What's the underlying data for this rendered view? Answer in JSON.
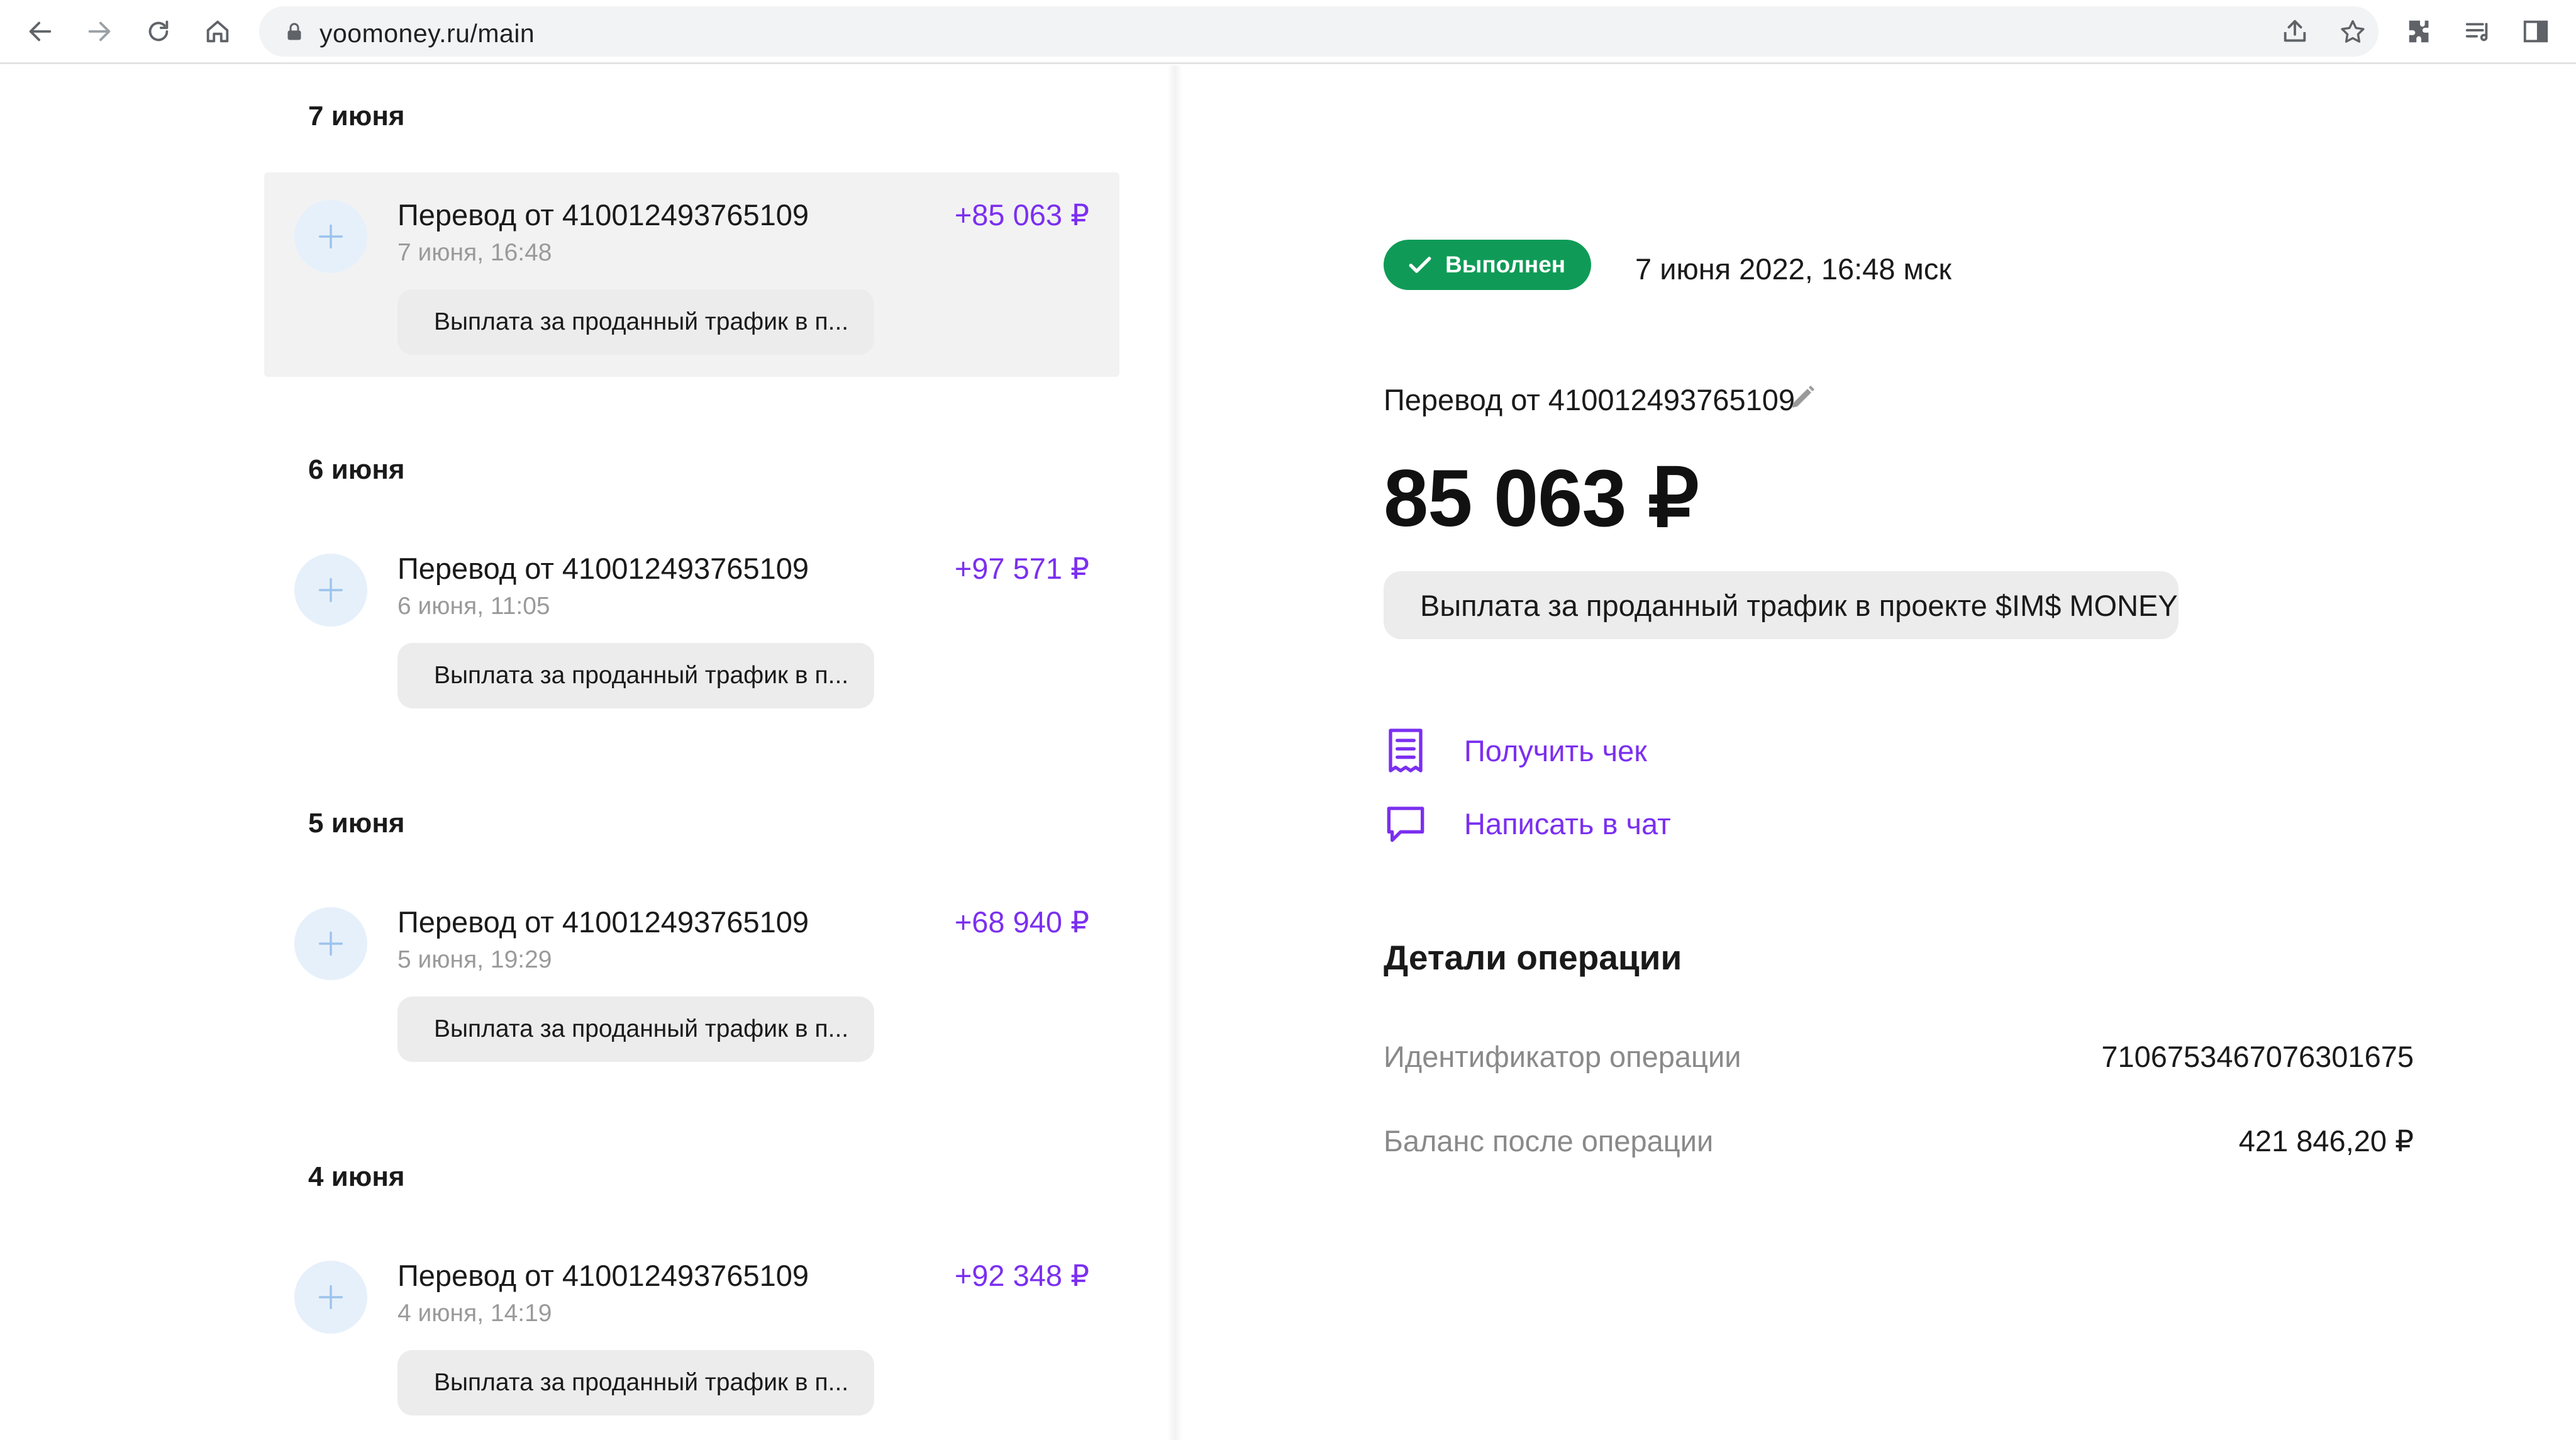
{
  "browser": {
    "url": "yoomoney.ru/main"
  },
  "list": {
    "groups": [
      {
        "date_header": "7 июня",
        "title": "Перевод от 410012493765109",
        "datetime": "7 июня, 16:48",
        "amount": "+85 063 ₽",
        "comment": "Выплата за проданный трафик в п..."
      },
      {
        "date_header": "6 июня",
        "title": "Перевод от 410012493765109",
        "datetime": "6 июня, 11:05",
        "amount": "+97 571 ₽",
        "comment": "Выплата за проданный трафик в п..."
      },
      {
        "date_header": "5 июня",
        "title": "Перевод от 410012493765109",
        "datetime": "5 июня, 19:29",
        "amount": "+68 940 ₽",
        "comment": "Выплата за проданный трафик в п..."
      },
      {
        "date_header": "4 июня",
        "title": "Перевод от 410012493765109",
        "datetime": "4 июня, 14:19",
        "amount": "+92 348 ₽",
        "comment": "Выплата за проданный трафик в п..."
      }
    ]
  },
  "detail": {
    "status": "Выполнен",
    "datetime": "7 июня 2022, 16:48 мск",
    "title": "Перевод от 410012493765109",
    "amount": "85 063 ₽",
    "comment": "Выплата за проданный трафик в проекте $IM$ MONEY",
    "actions": {
      "receipt": "Получить чек",
      "chat": "Написать в чат"
    },
    "section_title": "Детали операции",
    "rows": [
      {
        "label": "Идентификатор операции",
        "value": "710675346707630167​5"
      },
      {
        "label": "Баланс после операции",
        "value": "421 846,20 ₽"
      }
    ]
  },
  "colors": {
    "accent": "#7b2ff0",
    "status_green": "#0f9b57",
    "chip_bg": "#ececec",
    "selected_bg": "#f2f2f2",
    "icon_circle": "#e6f0fb"
  },
  "icons": {
    "back": "arrow-left-icon",
    "forward": "arrow-right-icon",
    "reload": "reload-icon",
    "home": "home-icon",
    "lock": "lock-icon",
    "share": "share-icon",
    "bookmark": "star-icon",
    "extensions": "puzzle-icon",
    "reading_list": "reading-list-icon",
    "side_panel": "side-panel-icon",
    "tx": "plus-icon",
    "status": "check-icon",
    "edit": "pencil-icon",
    "receipt": "receipt-icon",
    "chat": "chat-icon"
  }
}
